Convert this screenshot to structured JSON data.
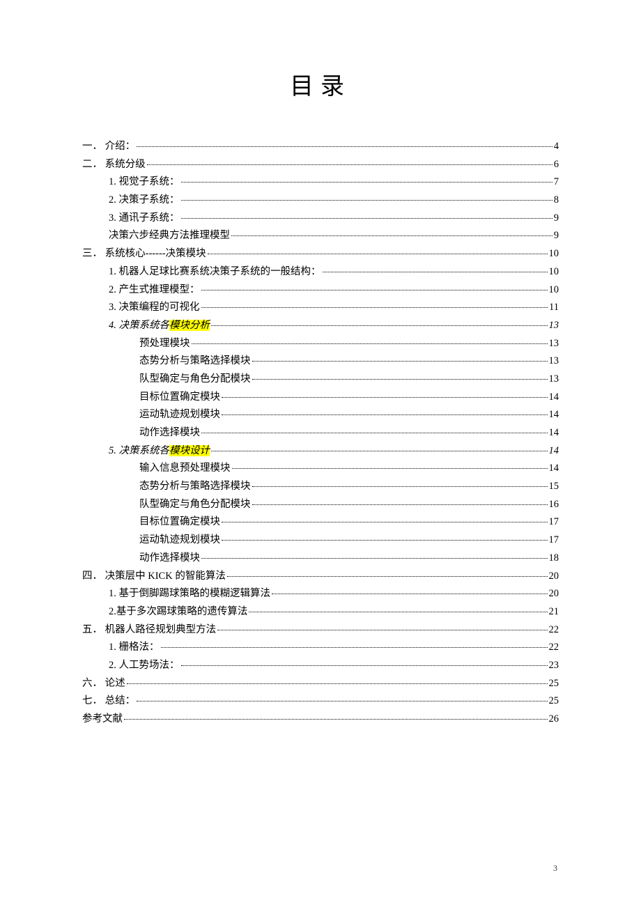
{
  "title": "目录",
  "page_number": "3",
  "toc": [
    {
      "indent": 0,
      "num": "一．",
      "text": "介绍：",
      "page": "4"
    },
    {
      "indent": 0,
      "num": "二．",
      "text": "系统分级",
      "page": "6"
    },
    {
      "indent": 1,
      "num": "1.",
      "text": "视觉子系统：",
      "page": "7"
    },
    {
      "indent": 1,
      "num": "2.",
      "text": "决策子系统：",
      "page": "8"
    },
    {
      "indent": 1,
      "num": "3.",
      "text": "通讯子系统：",
      "page": "9"
    },
    {
      "indent": 1,
      "num": "",
      "text": "决策六步经典方法推理模型",
      "page": "9"
    },
    {
      "indent": 0,
      "num": "三．",
      "text": "系统核心------决策模块",
      "page": "10"
    },
    {
      "indent": 1,
      "num": "1.",
      "text": "机器人足球比赛系统决策子系统的一般结构：",
      "page": "10"
    },
    {
      "indent": 1,
      "num": "2.",
      "text": "产生式推理模型：",
      "page": "10"
    },
    {
      "indent": 1,
      "num": "3.",
      "text": "决策编程的可视化",
      "page": "11"
    },
    {
      "indent": 1,
      "num": "4.",
      "text_pre": "决策系统各",
      "text_hl": "模块分析",
      "page": "13",
      "italic": true
    },
    {
      "indent": 2,
      "num": "",
      "text": "预处理模块",
      "page": "13"
    },
    {
      "indent": 2,
      "num": "",
      "text": "态势分析与策略选择模块",
      "page": "13"
    },
    {
      "indent": 2,
      "num": "",
      "text": "队型确定与角色分配模块",
      "page": "13"
    },
    {
      "indent": 2,
      "num": "",
      "text": "目标位置确定模块",
      "page": "14"
    },
    {
      "indent": 2,
      "num": "",
      "text": "运动轨迹规划模块",
      "page": "14"
    },
    {
      "indent": 2,
      "num": "",
      "text": "动作选择模块",
      "page": "14"
    },
    {
      "indent": 1,
      "num": "5.",
      "text_pre": "决策系统各",
      "text_hl": "模块设计",
      "page": "14",
      "italic": true
    },
    {
      "indent": 2,
      "num": "",
      "text": "输入信息预处理模块",
      "page": "14"
    },
    {
      "indent": 2,
      "num": "",
      "text": "态势分析与策略选择模块",
      "page": "15"
    },
    {
      "indent": 2,
      "num": "",
      "text": "队型确定与角色分配模块",
      "page": "16"
    },
    {
      "indent": 2,
      "num": "",
      "text": "目标位置确定模块",
      "page": "17"
    },
    {
      "indent": 2,
      "num": "",
      "text": "运动轨迹规划模块",
      "page": "17"
    },
    {
      "indent": 2,
      "num": "",
      "text": "动作选择模块",
      "page": "18"
    },
    {
      "indent": 0,
      "num": "四．",
      "text": "决策层中 KICK 的智能算法",
      "page": "20"
    },
    {
      "indent": 1,
      "num": "1.",
      "text": "基于倒脚踢球策略的模糊逻辑算法",
      "page": "20"
    },
    {
      "indent": 1,
      "num": "2.",
      "text": "基于多次踢球策略的遗传算法",
      "page": "21",
      "tight": true
    },
    {
      "indent": 0,
      "num": "五．",
      "text": "机器人路径规划典型方法",
      "page": "22"
    },
    {
      "indent": 1,
      "num": "1.",
      "text": "栅格法：",
      "page": "22"
    },
    {
      "indent": 1,
      "num": "2.",
      "text": "人工势场法：",
      "page": "23"
    },
    {
      "indent": 0,
      "num": "六．",
      "text": "论述",
      "page": "25"
    },
    {
      "indent": 0,
      "num": "七．",
      "text": "总结：",
      "page": "25"
    },
    {
      "indent": 0,
      "num": "",
      "text": "参考文献",
      "page": "26"
    }
  ]
}
